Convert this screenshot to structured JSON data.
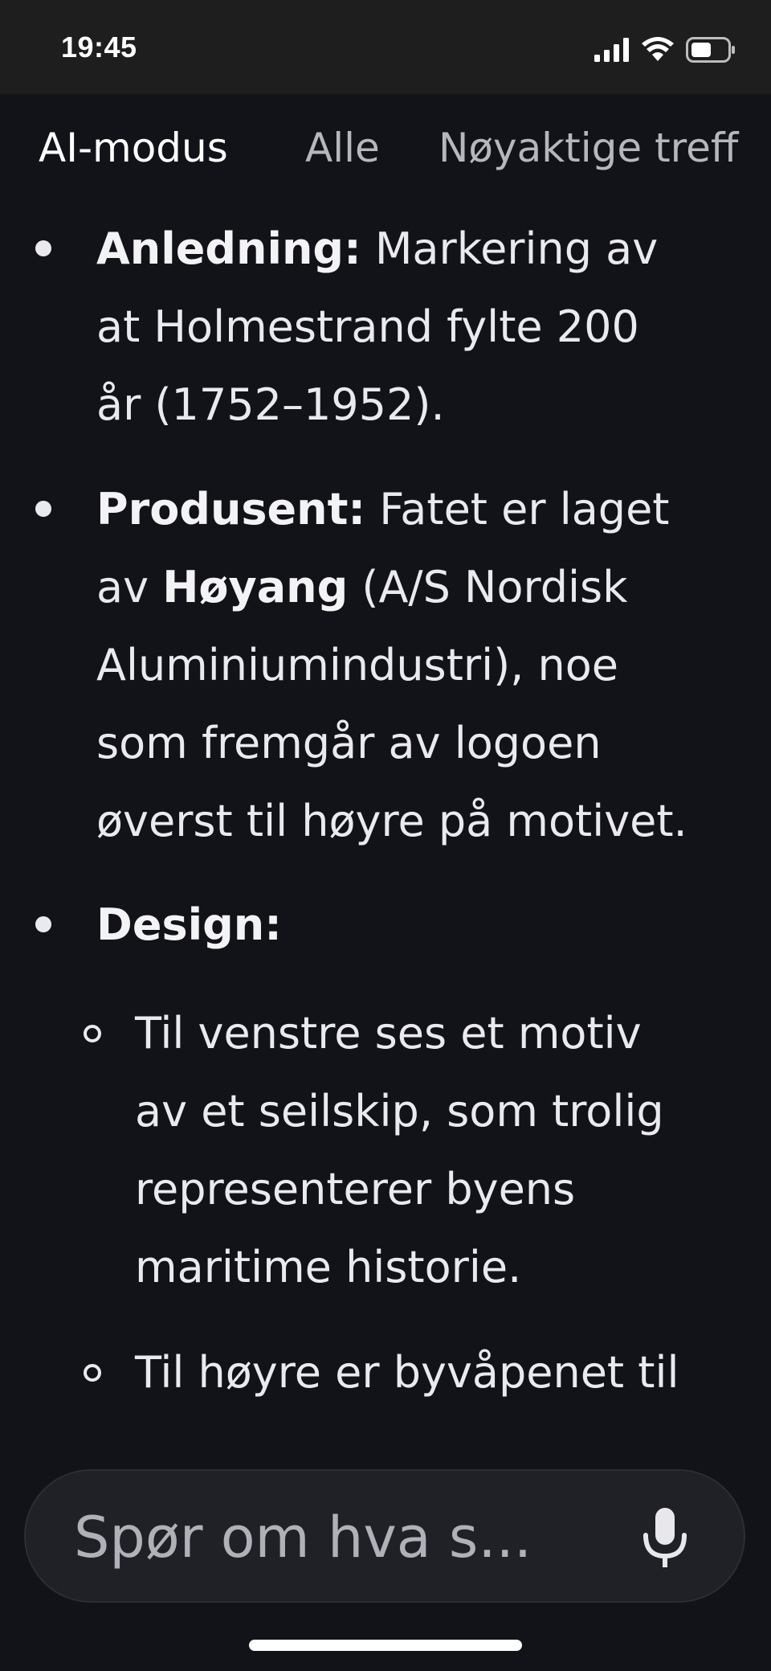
{
  "status": {
    "time": "19:45"
  },
  "tabs": [
    {
      "label": "AI-modus",
      "active": true
    },
    {
      "label": "Alle",
      "active": false
    },
    {
      "label": "Nøyaktige treff",
      "active": false
    }
  ],
  "content": {
    "item1": {
      "label": "Anledning:",
      "line1_rest": " Markering av",
      "line2": "at Holmestrand fylte 200",
      "line3": "år (1752–1952)."
    },
    "item2": {
      "label": "Produsent:",
      "line1_rest": " Fatet er laget",
      "line2_a": "av ",
      "line2_bold": "Høyang",
      "line2_b": " (A/S Nordisk",
      "line3": "Aluminiumindustri), noe",
      "line4": "som fremgår av logoen",
      "line5": "øverst til høyre på motivet."
    },
    "item3": {
      "label": "Design:"
    },
    "sub1": {
      "line1": "Til venstre ses et motiv",
      "line2": "av et seilskip, som trolig",
      "line3": "representerer byens",
      "line4": "maritime historie."
    },
    "sub2": {
      "line1": "Til høyre er byvåpenet til"
    }
  },
  "ask": {
    "placeholder": "Spør om hva s..."
  },
  "icons": {
    "signal": "signal-icon",
    "wifi": "wifi-icon",
    "battery": "battery-icon",
    "mic": "microphone-icon"
  }
}
